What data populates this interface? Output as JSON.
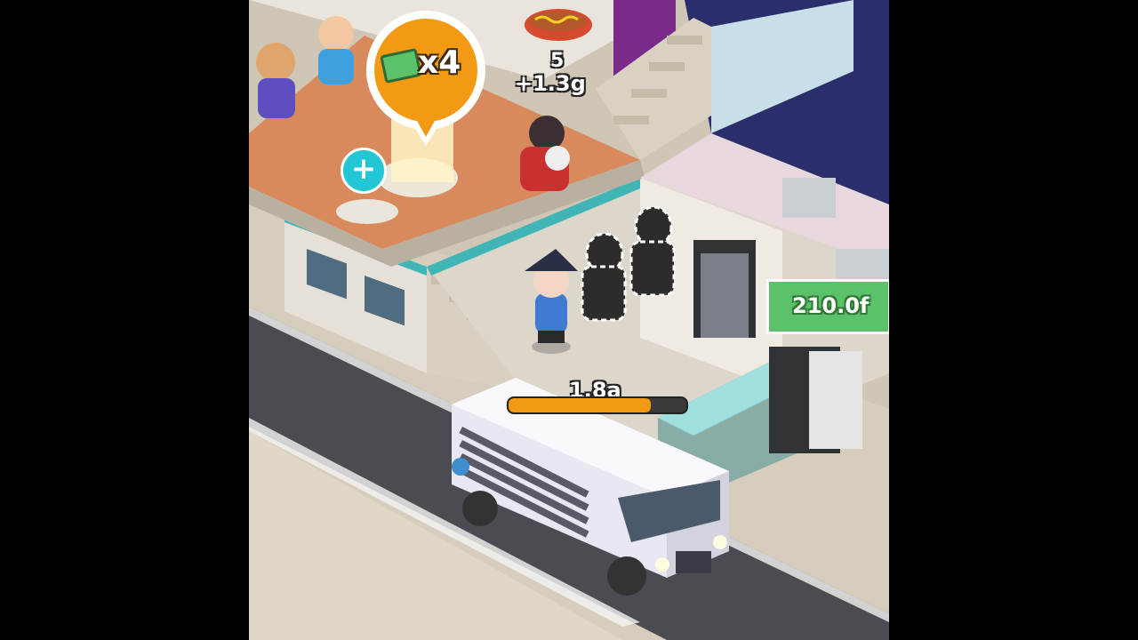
{
  "hud": {
    "multiplier_label": "x4",
    "float_count": "5",
    "float_amount": "+1.3g",
    "price_tag": "210.0f",
    "bus_label": "1.8a",
    "bus_progress": 0.8,
    "add_symbol": "+"
  },
  "icons": {
    "cash_icon": "cash-icon",
    "add_icon": "plus-icon"
  },
  "colors": {
    "multiplier_bubble": "#f29a14",
    "price_tag_bg": "#5bc16a",
    "progress_fill": "#f29a14",
    "add_button": "#23c6d4"
  }
}
